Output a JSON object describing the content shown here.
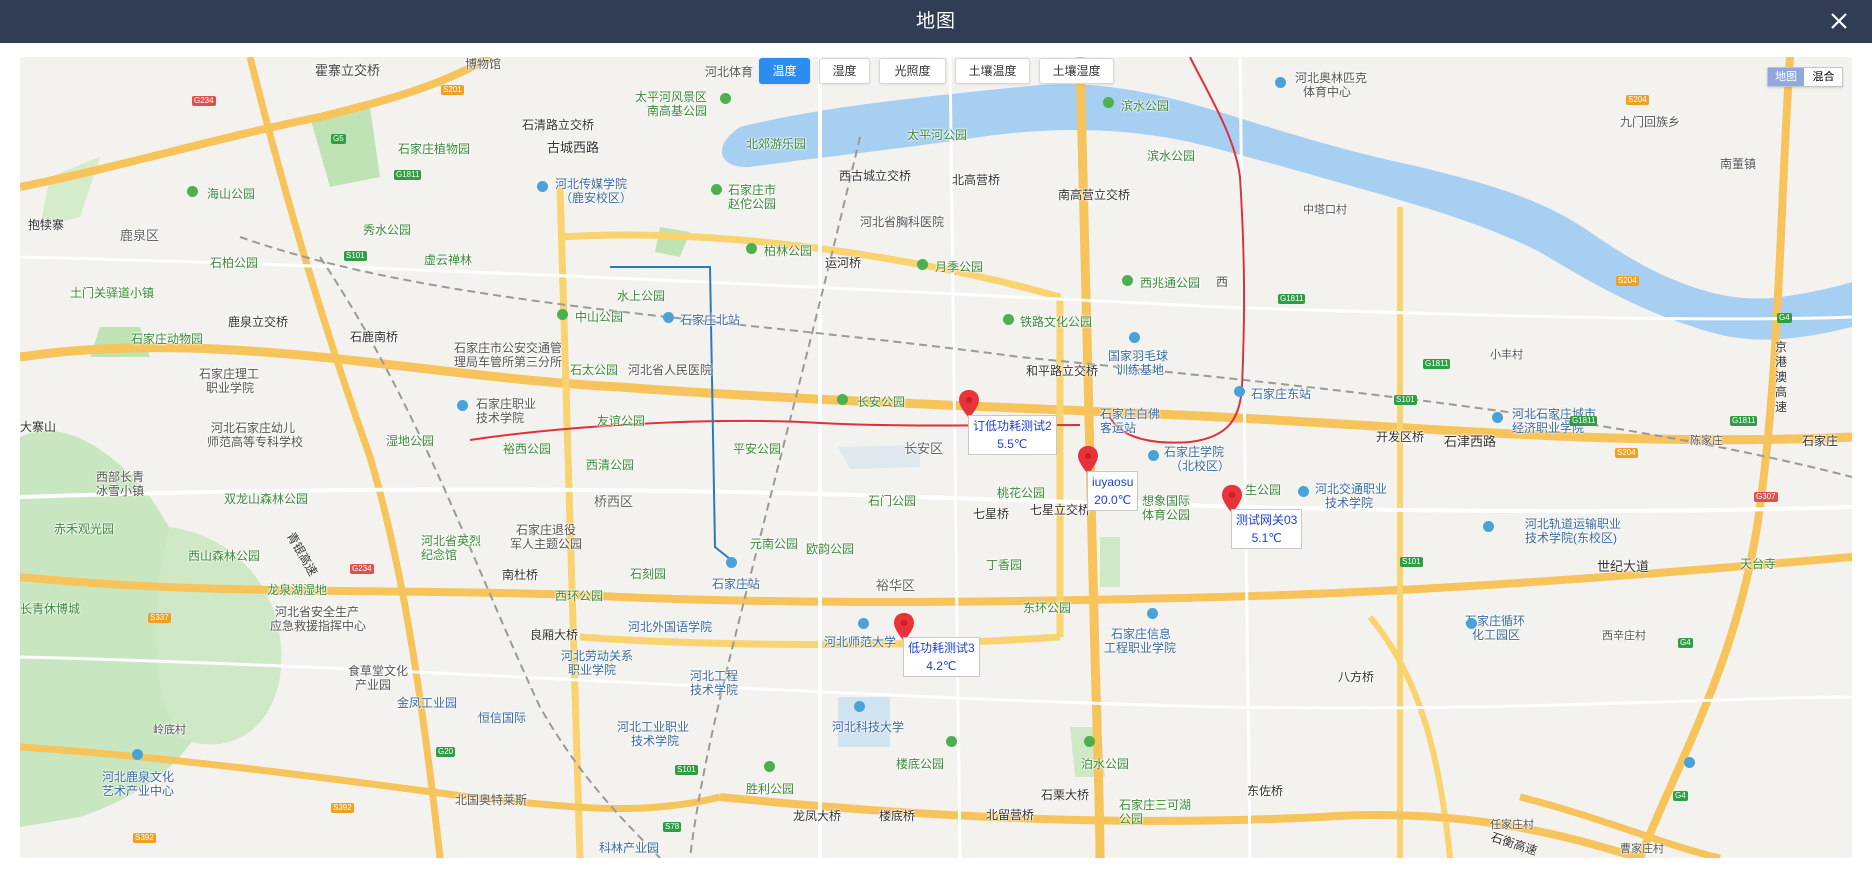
{
  "header": {
    "title": "地图"
  },
  "tabs": [
    {
      "label": "温度",
      "active": true
    },
    {
      "label": "湿度",
      "active": false
    },
    {
      "label": "光照度",
      "active": false
    },
    {
      "label": "土壤温度",
      "active": false
    },
    {
      "label": "土壤湿度",
      "active": false
    }
  ],
  "map_type": {
    "map": "地图",
    "hybrid": "混合"
  },
  "colors": {
    "header": "#303d54",
    "accent": "#2d8cf0",
    "marker": "#e8333a"
  },
  "markers": [
    {
      "name": "订低功耗测试2",
      "value": "5.5℃"
    },
    {
      "name": "iuyaosu",
      "value": "20.0℃"
    },
    {
      "name": "测试网关03",
      "value": "5.1℃"
    },
    {
      "name": "低功耗测试3",
      "value": "4.2℃"
    }
  ],
  "labels": {
    "huozhai": "霍寨立交桥",
    "bowuguan": "博物馆",
    "hebeitiyu": "河北体育",
    "aolinpike": "河北奥林匹克",
    "tiyuzhongxin": "体育中心",
    "jiumen": "九门回族乡",
    "nandong": "南董镇",
    "taiping": "太平河风景区",
    "nangaoji": "南高基公园",
    "binshui": "滨水公园",
    "binshui2": "滨水公园",
    "taipinghe": "太平河公园",
    "gucheng": "古城西路",
    "shiqing": "石清路立交桥",
    "zhiwuyuan": "石家庄植物园",
    "beiyou": "北郊游乐园",
    "xigucheng": "西古城立交桥",
    "beigaoying": "北高营桥",
    "nangaoying": "南高营立交桥",
    "zhongtou": "中塔口村",
    "haishan": "海山公园",
    "chuanmei": "河北传媒学院",
    "yananxiaoqu": "（鹿安校区）",
    "zhaotuo1": "石家庄市",
    "zhaotuo2": "赵佗公园",
    "xiongke": "河北省胸科医院",
    "baohuzhai": "抱犊寨",
    "luquanqu": "鹿泉区",
    "xiushui": "秀水公园",
    "shibai": "石柏公园",
    "xuyun": "虚云禅林",
    "bailin": "柏林公园",
    "yunhe": "运河桥",
    "yueji": "月季公园",
    "xizhaotong": "西兆通公园",
    "xi": "西",
    "tumen": "土门关驿道小镇",
    "shuishang": "水上公园",
    "zhongshan": "中山公园",
    "beizhan": "石家庄北站",
    "tielu": "铁路文化公园",
    "dongwuyuan": "石家庄动物园",
    "luquanli": "鹿泉立交桥",
    "shilunan": "石鹿南桥",
    "gonganju1": "石家庄市公安交通管",
    "gonganju2": "理局车管所第三分所",
    "renmin": "河北省人民医院",
    "shitai": "石太公园",
    "yumao1": "国家羽毛球",
    "yumao2": "训练基地",
    "heping": "和平路立交桥",
    "dongzhan": "石家庄东站",
    "xiaofeng": "小丰村",
    "jinggang1": "京",
    "jinggang2": "港",
    "jinggang3": "澳",
    "jinggang4": "高",
    "jinggang5": "速",
    "ligong1": "石家庄理工",
    "ligong2": "职业学院",
    "zhiye1": "石家庄职业",
    "zhiye2": "技术学院",
    "changan": "长安公园",
    "baifo1": "石家庄白佛",
    "baifo2": "客运站",
    "chengshi1": "河北石家庄城市",
    "chengshi2": "经济职业学院",
    "youer1": "河北石家庄幼儿",
    "youer2": "师范高等专科学校",
    "dazhai": "大寨山",
    "youyi": "友谊公园",
    "shidi": "湿地公园",
    "yuyuan": "裕西公园",
    "xiqing": "西清公园",
    "pingan": "平安公园",
    "changanqu": "长安区",
    "shixueyuan1": "石家庄学院",
    "shixueyuan2": "（北校区）",
    "kaifaqu": "开发区桥",
    "shijin": "石津西路",
    "chenjiazhuang": "陈家庄",
    "shijiazhuang": "石家庄",
    "xibu1": "西部长青",
    "xibu2": "冰雪小镇",
    "qiaoxi": "桥西区",
    "shimen": "石门公园",
    "taohua": "桃花公园",
    "qixing": "七星桥",
    "qixingli": "七星立交桥",
    "xiangmeng1": "想象国际",
    "xiangmeng2": "体育公园",
    "sheng": "生公园",
    "jiaotong1": "河北交通职业",
    "jiaotong2": "技术学院",
    "shuanglong": "双龙山森林公园",
    "chihe": "赤禾观光园",
    "tuiyi1": "石家庄退役",
    "tuiyi2": "军人主题公园",
    "lieshi1": "河北省英烈",
    "lieshi2": "纪念馆",
    "yuandong": "元南公园",
    "ouyin": "欧韵公园",
    "qingdao": "青银高速",
    "guidao1": "河北轨道运输职业",
    "guidao2": "技术学院(东校区)",
    "xishan": "西山森林公园",
    "dingxiang": "丁香园",
    "tiantai": "天台寺",
    "nandu": "南杜桥",
    "shike": "石刻园",
    "shijiazhuangzhan": "石家庄站",
    "yuhua": "裕华区",
    "dongfang": "东环公园",
    "shiji": "世纪大道",
    "longquan": "龙泉湖湿地",
    "changqing": "长青休博城",
    "xihuan": "西环公园",
    "anquan1": "河北省安全生产",
    "anquan2": "应急救援指挥中心",
    "waiguoyu": "河北外国语学院",
    "xinxi1": "石家庄信息",
    "xinxi2": "工程职业学院",
    "xunhuan1": "石家庄循环",
    "xunhuan2": "化工园区",
    "xixinzhuang": "西辛庄村",
    "shifan": "河北师范大学",
    "liangcun": "良厢大桥",
    "laodong1": "河北劳动关系",
    "laodong2": "职业学院",
    "shicaotang1": "食草堂文化",
    "shicaotang2": "产业园",
    "gongcheng1": "河北工程",
    "gongcheng2": "技术学院",
    "bafang": "八方桥",
    "jinfeng": "金凤工业园",
    "hengxin": "恒信国际",
    "gongye1": "河北工业职业",
    "gongye2": "技术学院",
    "keji": "河北科技大学",
    "lingdi": "岭底村",
    "loudi": "楼底公园",
    "bochui": "泊水公园",
    "luquan1": "河北鹿泉文化",
    "luquan2": "艺术产业中心",
    "aotelaisi": "北国奥特莱斯",
    "shengli": "胜利公园",
    "shisu": "石栗大桥",
    "sanke1": "石家庄三可湖",
    "sanke2": "公园",
    "dongzuo": "东佐桥",
    "renjia": "任家庄村",
    "shiheng": "石衡高速",
    "caojia": "曹家庄村",
    "longfeng": "龙凤大桥",
    "loudiqiao": "楼底桥",
    "beiliuying": "北留营桥",
    "kelin": "科林产业园"
  }
}
